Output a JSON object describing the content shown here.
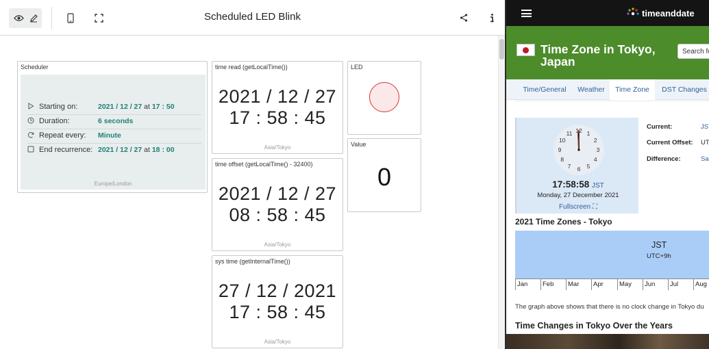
{
  "dashboard": {
    "title": "Scheduled LED Blink",
    "toolbar_icons": [
      "eye-icon",
      "pencil-icon",
      "phone-icon",
      "fullscreen-icon",
      "share-icon",
      "info-icon"
    ]
  },
  "scheduler": {
    "label": "Scheduler",
    "rows": [
      {
        "icon": "play-icon",
        "label": "Starting on:",
        "value": "2021 / 12 / 27",
        "at": "at",
        "value2": "17 : 50"
      },
      {
        "icon": "clock-icon",
        "label": "Duration:",
        "value": "6 seconds"
      },
      {
        "icon": "repeat-icon",
        "label": "Repeat every:",
        "value": "Minute"
      },
      {
        "icon": "checkbox-icon",
        "label": "End recurrence:",
        "value": "2021 / 12 / 27",
        "at": "at",
        "value2": "18 : 00"
      }
    ],
    "timezone": "Europe/London"
  },
  "time_read": {
    "label": "time read (getLocalTime())",
    "date": "2021 / 12 / 27",
    "time": "17 : 58 : 45",
    "timezone": "Asia/Tokyo"
  },
  "time_offset": {
    "label": "time offset (getLocalTime() - 32400)",
    "date": "2021 / 12 / 27",
    "time": "08 : 58 : 45",
    "timezone": "Asia/Tokyo"
  },
  "sys_time": {
    "label": "sys time (getInternalTime())",
    "date": "27 / 12 / 2021",
    "time": "17 : 58 : 45",
    "timezone": "Asia/Tokyo"
  },
  "led": {
    "label": "LED",
    "color": "#fbe9e9"
  },
  "value": {
    "label": "Value",
    "number": "0"
  },
  "browser": {
    "logo": "timeanddate",
    "banner_title": "Time Zone in Tokyo, Japan",
    "search_placeholder": "Search fo",
    "tabs": [
      "Time/General",
      "Weather",
      "Time Zone",
      "DST Changes"
    ],
    "active_tab": "Time Zone",
    "clock": {
      "numerals": [
        "12",
        "1",
        "2",
        "3",
        "4",
        "5",
        "6",
        "7",
        "8",
        "9",
        "10",
        "11"
      ],
      "time": "17:58:58",
      "zone": "JST",
      "date": "Monday, 27 December 2021",
      "fullscreen": "Fullscreen"
    },
    "info": [
      {
        "label": "Current:",
        "value": "JST"
      },
      {
        "label": "Current Offset:",
        "value": "UTC"
      },
      {
        "label": "Difference:",
        "value": "Sa"
      }
    ],
    "zones_title": "2021 Time Zones - Tokyo",
    "zone_abbr": "JST",
    "zone_utc": "UTC+9h",
    "months": [
      "Jan",
      "Feb",
      "Mar",
      "Apr",
      "May",
      "Jun",
      "Jul",
      "Aug"
    ],
    "graph_note": "The graph above shows that there is no clock change in Tokyo du",
    "changes_title": "Time Changes in Tokyo Over the Years"
  }
}
